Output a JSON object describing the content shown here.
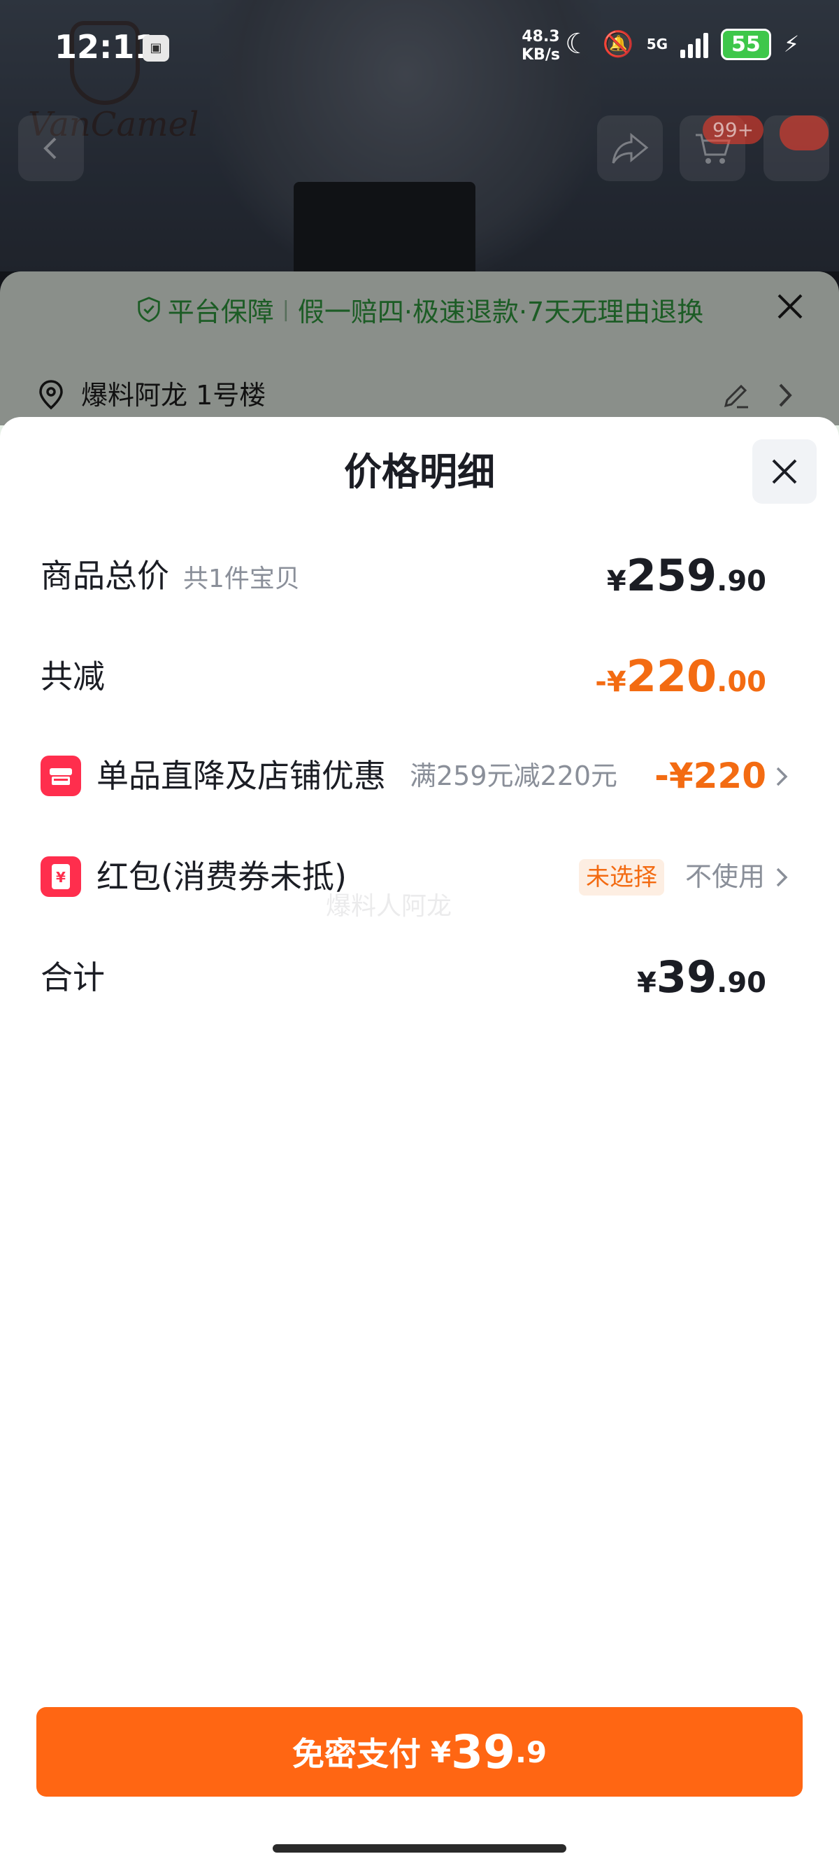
{
  "status_bar": {
    "time": "12:11",
    "net_speed_value": "48.3",
    "net_speed_unit": "KB/s",
    "network": "5G",
    "battery": "55"
  },
  "background": {
    "cart_badge": "99+",
    "guarantee": {
      "label": "平台保障",
      "items": "假一赔四·极速退款·7天无理由退换"
    },
    "address": "爆料阿龙 1号楼"
  },
  "sheet": {
    "title": "价格明细",
    "rows": {
      "subtotal": {
        "label": "商品总价",
        "sub": "共1件宝贝",
        "currency": "¥",
        "int": "259",
        "dec": ".90"
      },
      "discount_total": {
        "label": "共减",
        "currency": "-¥",
        "int": "220",
        "dec": ".00"
      },
      "shop_discount": {
        "label": "单品直降及店铺优惠",
        "sub": "满259元减220元",
        "value": "-¥220"
      },
      "red_packet": {
        "label": "红包(消费券未抵)",
        "badge": "未选择",
        "action": "不使用"
      },
      "total": {
        "label": "合计",
        "currency": "¥",
        "int": "39",
        "dec": ".90"
      }
    },
    "watermark": "爆料人阿龙"
  },
  "pay_button": {
    "label": "免密支付",
    "currency": "¥",
    "int": "39",
    "dec": ".9"
  },
  "colors": {
    "accent_orange": "#ff6613",
    "price_orange": "#f36b12",
    "icon_red": "#ff2e4d",
    "guarantee_green": "#2f9a3e"
  },
  "icons": [
    "shield-check-icon",
    "location-pin-icon",
    "edit-icon",
    "chevron-right-icon",
    "close-icon",
    "shop-icon",
    "red-packet-icon",
    "share-icon",
    "cart-icon",
    "back-icon"
  ]
}
